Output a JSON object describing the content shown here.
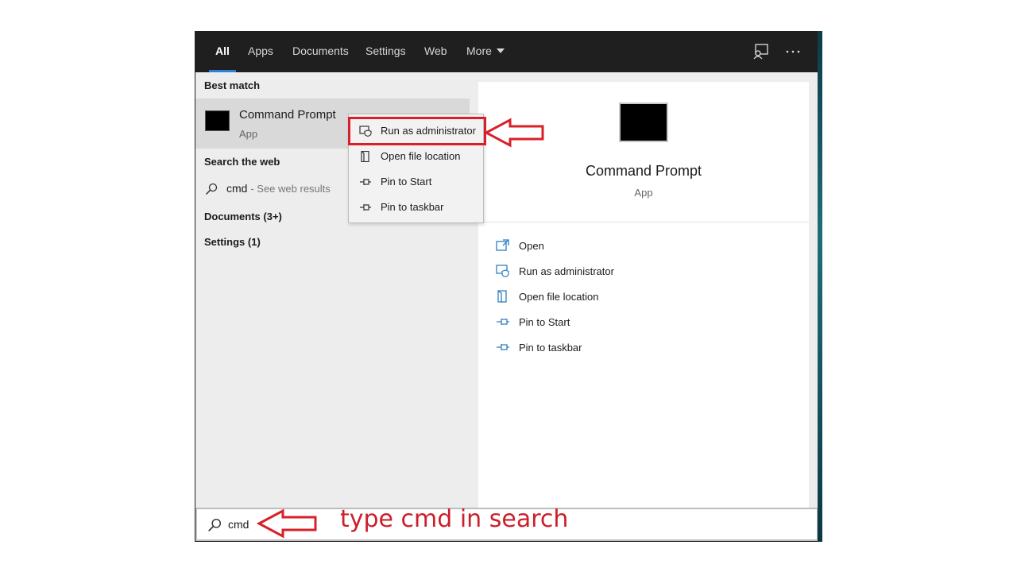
{
  "tabs": [
    {
      "label": "All",
      "active": true
    },
    {
      "label": "Apps"
    },
    {
      "label": "Documents"
    },
    {
      "label": "Settings"
    },
    {
      "label": "Web"
    },
    {
      "label": "More"
    }
  ],
  "toolbar_icons": [
    "feedback-icon",
    "more-options-icon"
  ],
  "left": {
    "best_match_heading": "Best match",
    "best_match": {
      "title": "Command Prompt",
      "subtitle": "App"
    },
    "search_web_heading": "Search the web",
    "web_query": "cmd",
    "web_suffix": "- See web results",
    "documents": "Documents (3+)",
    "settings": "Settings (1)"
  },
  "context_menu": [
    {
      "label": "Run as administrator",
      "icon": "shield-window-icon"
    },
    {
      "label": "Open file location",
      "icon": "folder-icon"
    },
    {
      "label": "Pin to Start",
      "icon": "pin-icon"
    },
    {
      "label": "Pin to taskbar",
      "icon": "pin-icon"
    }
  ],
  "right": {
    "title": "Command Prompt",
    "subtitle": "App",
    "actions": [
      {
        "label": "Open",
        "icon": "open-icon"
      },
      {
        "label": "Run as administrator",
        "icon": "shield-window-icon"
      },
      {
        "label": "Open file location",
        "icon": "folder-icon"
      },
      {
        "label": "Pin to Start",
        "icon": "pin-icon"
      },
      {
        "label": "Pin to taskbar",
        "icon": "pin-icon"
      }
    ]
  },
  "search": {
    "value": "cmd"
  },
  "annotation": {
    "text": "type cmd in search",
    "color": "#cc1f2a"
  },
  "colors": {
    "accent": "#2f80d8",
    "tabbar": "#1f1f1f",
    "highlight": "#d9202a"
  }
}
